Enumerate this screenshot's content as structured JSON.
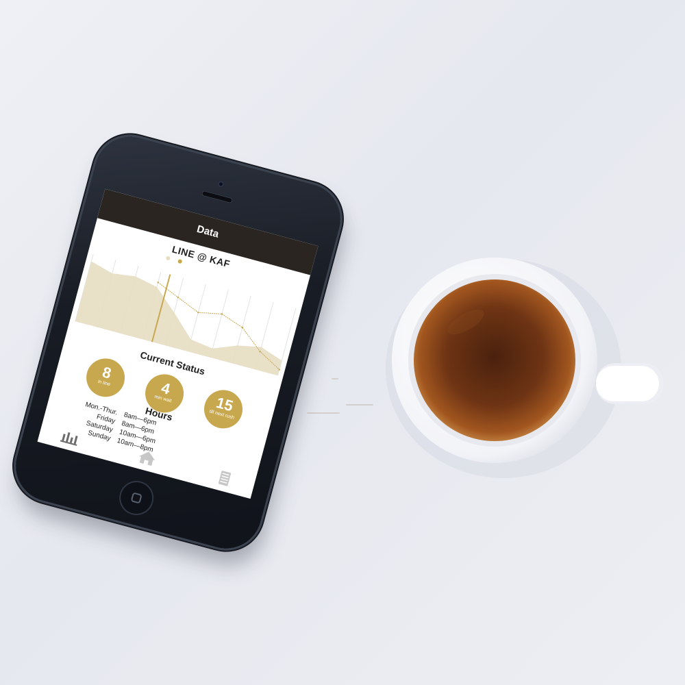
{
  "app": {
    "nav_title": "Data",
    "accent_color": "#c8a84e",
    "nav_color": "#2a2521"
  },
  "chart": {
    "title": "LINE @ KAF",
    "legend": [
      {
        "label": "",
        "color": "#e7ddc2"
      },
      {
        "label": "",
        "color": "#c8a84e"
      }
    ],
    "time_labels": [
      "",
      "",
      "",
      "",
      "",
      "",
      "",
      "",
      "",
      ""
    ]
  },
  "chart_data": {
    "type": "area",
    "title": "LINE @ KAF",
    "x": [
      0,
      1,
      2,
      3,
      4,
      5,
      6,
      7,
      8,
      9
    ],
    "series": [
      {
        "name": "",
        "values": [
          4,
          3.6,
          3.8,
          3.5,
          2.2,
          0.8,
          0.6,
          1.2,
          1.5,
          1.0
        ]
      },
      {
        "name": "",
        "values": [
          null,
          null,
          null,
          3.8,
          3.2,
          2.6,
          2.9,
          2.4,
          1.2,
          0.4
        ]
      }
    ],
    "grid": true
  },
  "status": {
    "title": "Current Status",
    "items": [
      {
        "value": "8",
        "label": "in line"
      },
      {
        "value": "4",
        "label": "min wait"
      },
      {
        "value": "15",
        "label": "till next rush"
      }
    ]
  },
  "hours": {
    "title": "Hours",
    "rows": [
      {
        "day": "Mon.-Thur.",
        "time": "8am—6pm"
      },
      {
        "day": "Friday",
        "time": "8am—6pm"
      },
      {
        "day": "Saturday",
        "time": "10am—6pm"
      },
      {
        "day": "Sunday",
        "time": "10am—8pm"
      }
    ]
  },
  "tabs": [
    {
      "icon": "bar-chart-icon",
      "active": true
    },
    {
      "icon": "home-icon",
      "active": false
    },
    {
      "icon": "list-icon",
      "active": false
    }
  ]
}
